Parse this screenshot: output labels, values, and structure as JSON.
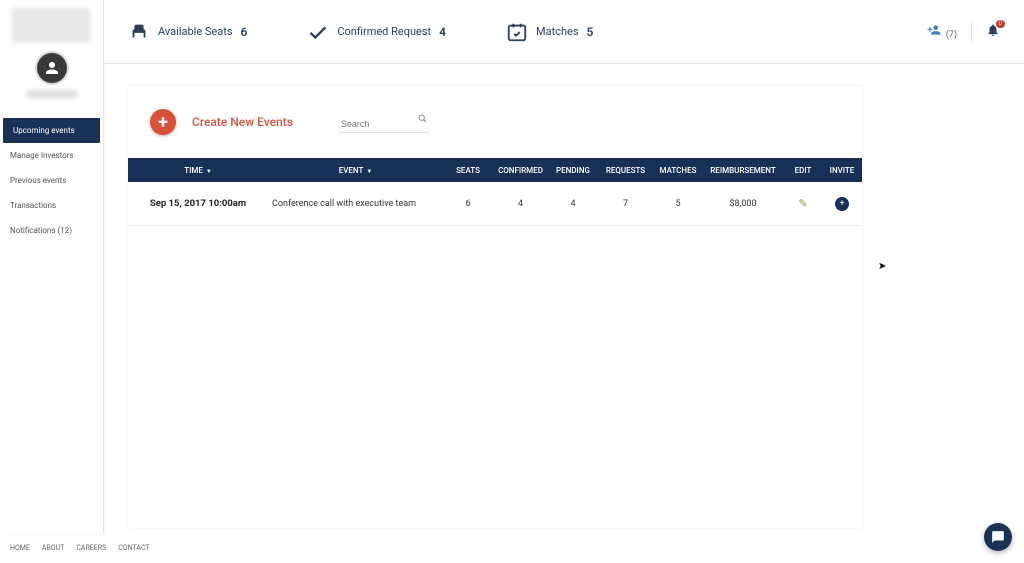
{
  "sidebar": {
    "items": [
      {
        "label": "Upcoming events"
      },
      {
        "label": "Manage Investors"
      },
      {
        "label": "Previous events"
      },
      {
        "label": "Transactions"
      },
      {
        "label": "Notifications (12)"
      }
    ]
  },
  "topbar": {
    "metrics": [
      {
        "label": "Available Seats",
        "value": "6"
      },
      {
        "label": "Confirmed Request",
        "value": "4"
      },
      {
        "label": "Matches",
        "value": "5"
      }
    ],
    "friend_count": "(7)"
  },
  "create": {
    "label": "Create New Events",
    "search_placeholder": "Search"
  },
  "table": {
    "headers": {
      "time": "TIME",
      "event": "EVENT",
      "seats": "SEATS",
      "confirmed": "CONFIRMED",
      "pending": "PENDING",
      "requests": "REQUESTS",
      "matches": "MATCHES",
      "reimbursement": "REIMBURSEMENT",
      "edit": "EDIT",
      "invite": "INVITE"
    },
    "rows": [
      {
        "time": "Sep 15, 2017  10:00am",
        "event": "Conference call with executive team",
        "seats": "6",
        "confirmed": "4",
        "pending": "4",
        "requests": "7",
        "matches": "5",
        "reimbursement": "$8,000"
      }
    ]
  },
  "footer": {
    "links": [
      {
        "label": "HOME"
      },
      {
        "label": "ABOUT"
      },
      {
        "label": "CAREERS"
      },
      {
        "label": "CONTACT"
      }
    ]
  }
}
